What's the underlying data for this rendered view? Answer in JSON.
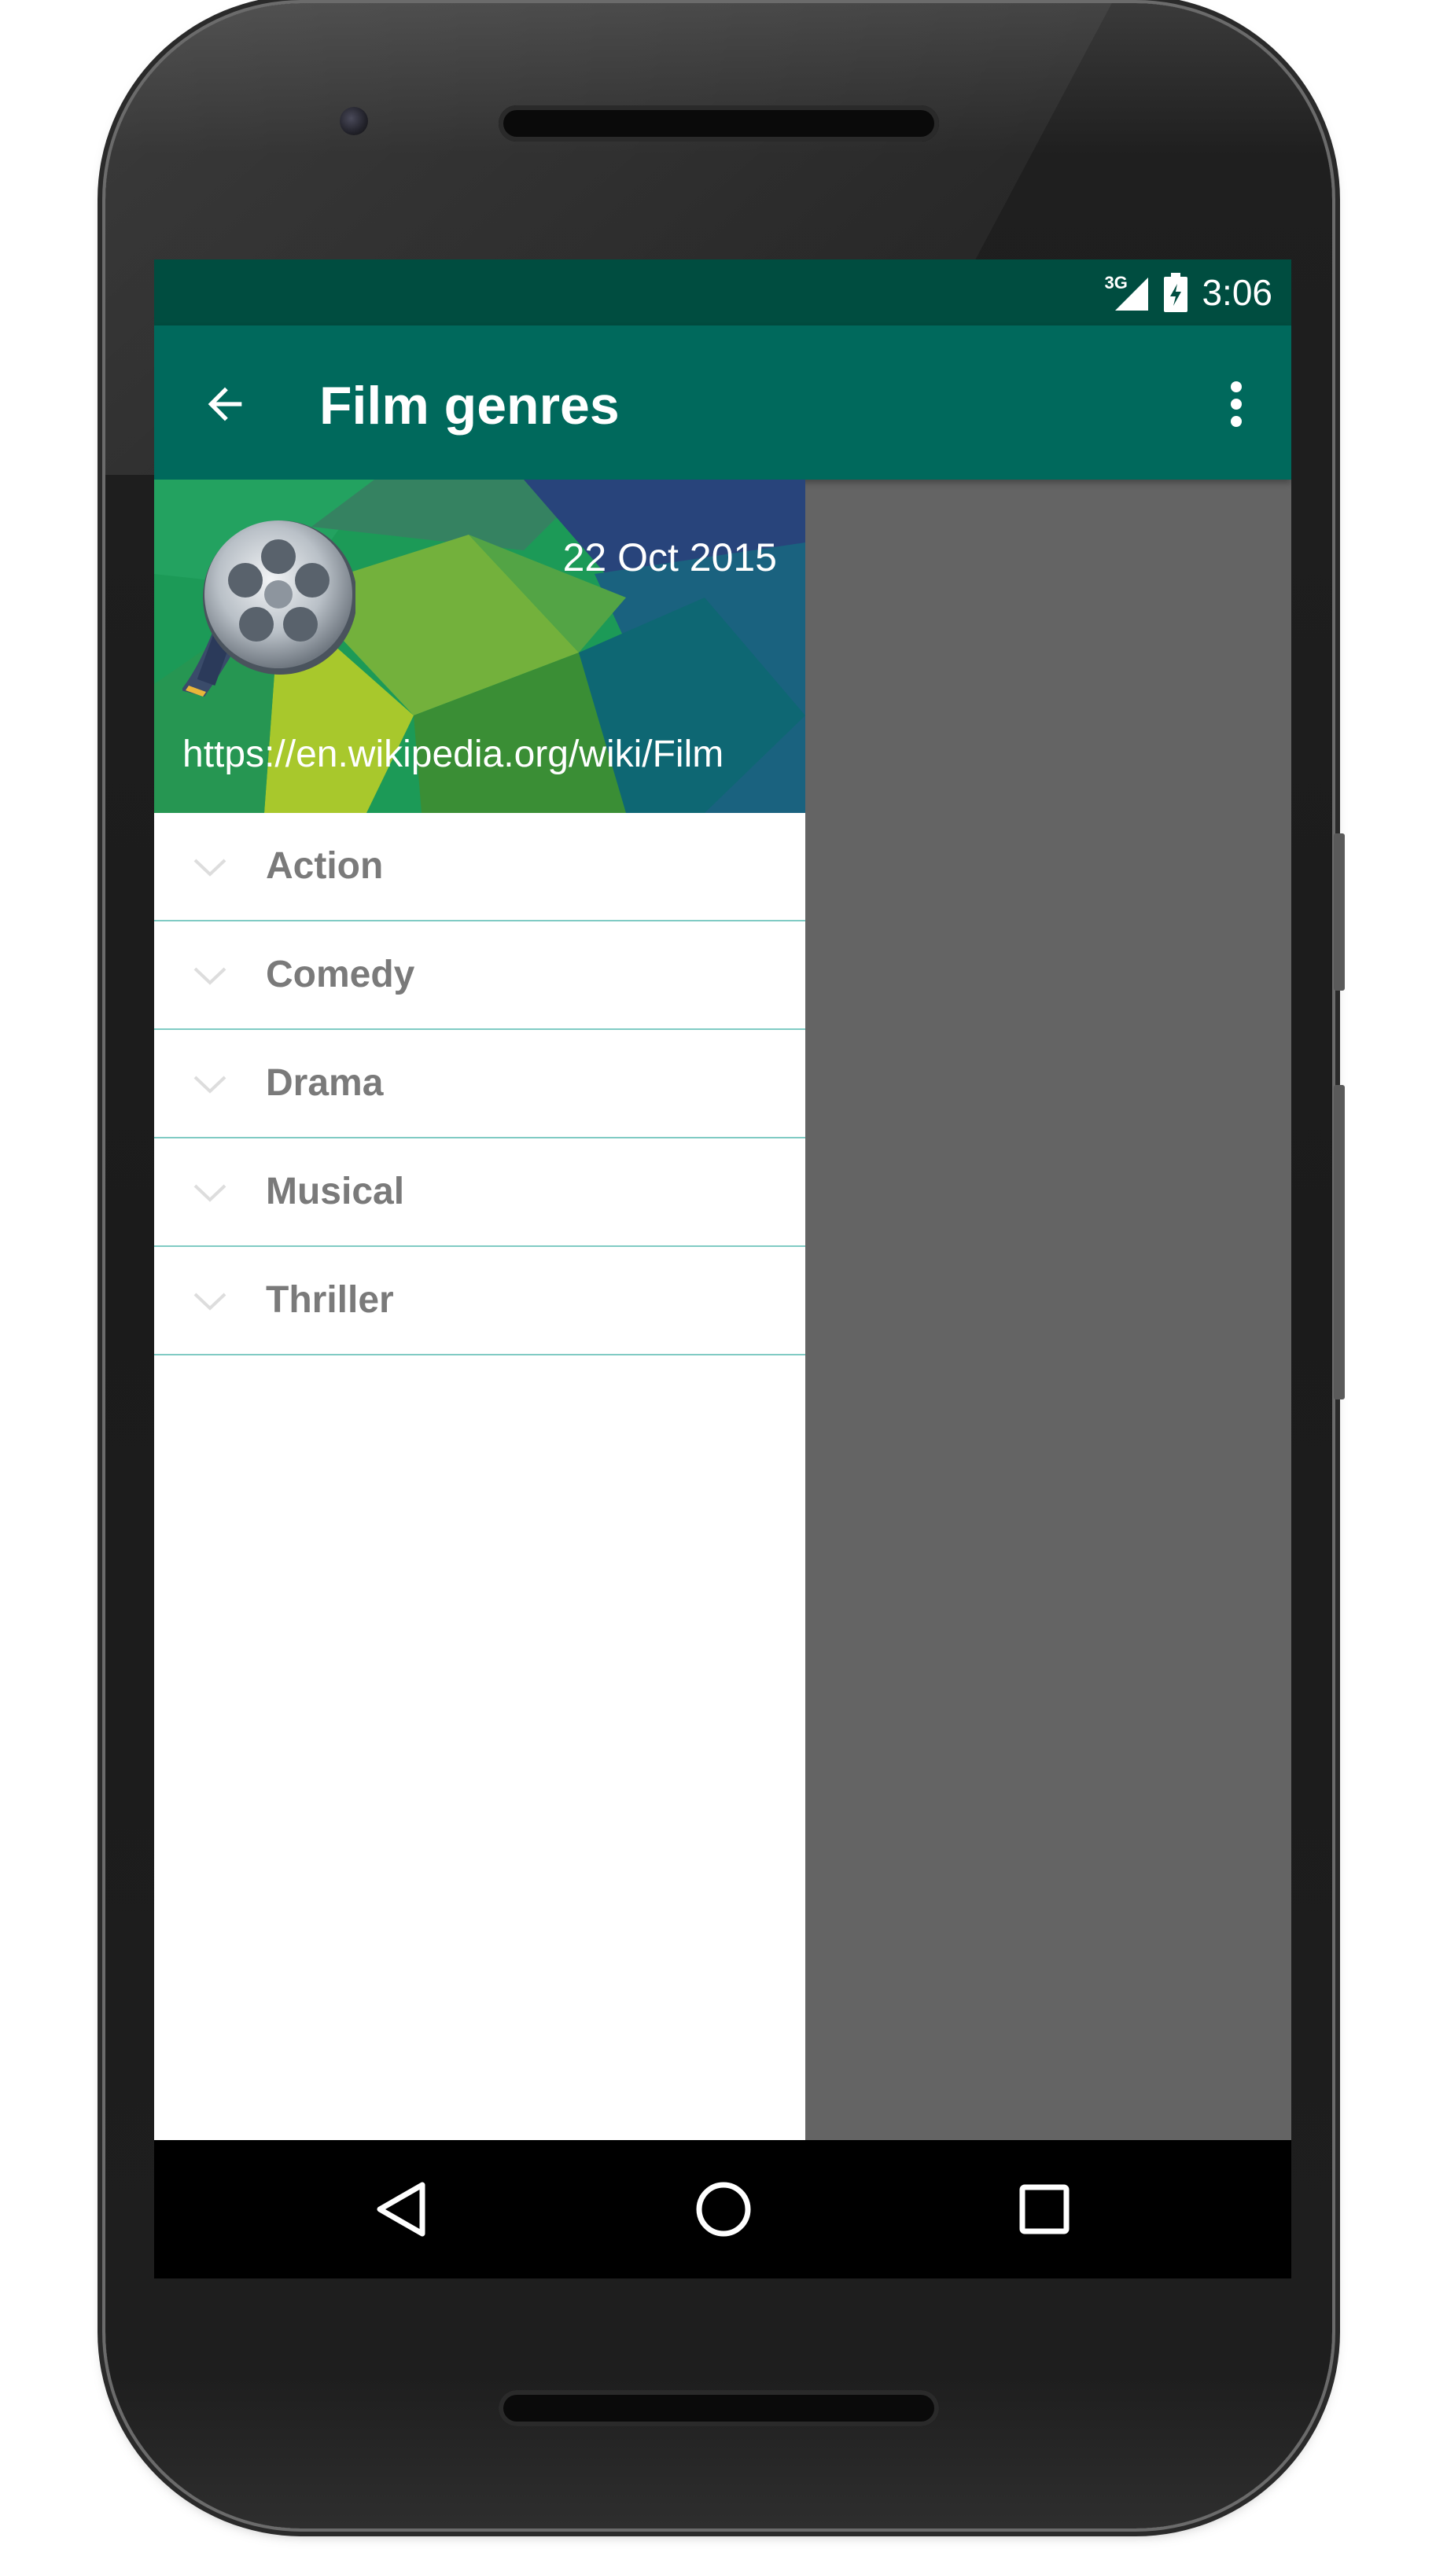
{
  "status_bar": {
    "network_label": "3G",
    "time": "3:06"
  },
  "app_bar": {
    "title": "Film genres",
    "back_icon": "arrow-back-icon",
    "menu_icon": "more-vert-icon"
  },
  "drawer_header": {
    "date": "22 Oct 2015",
    "url": "https://en.wikipedia.org/wiki/Film",
    "image_icon": "film-reel-icon"
  },
  "genres": [
    {
      "label": "Action"
    },
    {
      "label": "Comedy"
    },
    {
      "label": "Drama"
    },
    {
      "label": "Musical"
    },
    {
      "label": "Thriller"
    }
  ],
  "nav_bar": {
    "back_icon": "nav-back-icon",
    "home_icon": "nav-home-icon",
    "recents_icon": "nav-recents-icon"
  },
  "colors": {
    "status_bar": "#004d40",
    "app_bar": "#00695c",
    "divider": "#80cbc4",
    "scrim": "#646464"
  }
}
